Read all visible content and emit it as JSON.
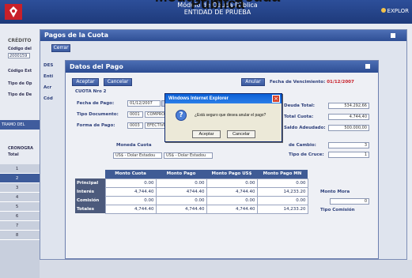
{
  "header": {
    "overlay_title": "Módulo de Deuda Pública",
    "title": "Módulo de Deuda Pública",
    "subtitle": "ENTIDAD DE PRUEBA",
    "user": "EXPLOR"
  },
  "background": {
    "credito_label": "CRÉDITO",
    "labels": [
      "Código del",
      "Código Ext",
      "Tipo de Op",
      "Tipo de De"
    ],
    "input_value": "2000159",
    "tramo_label": "TRAMO DEL",
    "cronograma_label": "CRONOGRA",
    "total_label": "Total",
    "grid_rows": [
      "1",
      "2",
      "3",
      "4",
      "5",
      "6",
      "7",
      "8"
    ]
  },
  "pagos_window": {
    "title": "Pagos de la Cuota",
    "cerrar": "Cerrar",
    "side_labels": [
      "DES",
      "Enti",
      "Acr",
      "Cód"
    ]
  },
  "datos_window": {
    "title": "Datos del Pago",
    "aceptar": "Aceptar",
    "cancelar": "Cancelar",
    "anular": "Anular",
    "fecha_venc_label": "Fecha de Vencimiento:",
    "fecha_venc_value": "01/12/2007",
    "cuota": "CUOTA Nro 2",
    "fecha_pago_label": "Fecha de Pago:",
    "fecha_pago_value": "01/12/2007",
    "tipo_doc_label": "Tipo Documento:",
    "tipo_doc_code": "0001",
    "tipo_doc_value": "COMPRO",
    "forma_pago_label": "Forma de Pago:",
    "forma_pago_code": "0003",
    "forma_pago_value": "EFECTIVO",
    "deuda_total_label": "Deuda Total:",
    "deuda_total_value": "534.292,66",
    "total_cuota_label": "Total Cuota:",
    "total_cuota_value": "4.744,40",
    "saldo_label": "Saldo Adeudado:",
    "saldo_value": "500.000,00",
    "tipo_cambio_label": "de Cambio:",
    "tipo_cambio_value": "3",
    "tipo_cruce_label": "Tipo de Cruce:",
    "tipo_cruce_value": "1",
    "moneda_cuota_label": "Moneda Cuota",
    "moneda_cuota_value": "US$ - Dolar Estadou",
    "moneda_pago_value": "US$ - Dolar Estadou",
    "monto_mora_label": "Monto Mora",
    "tipo_comision_label": "Tipo Comisión",
    "mora_value": "0"
  },
  "table": {
    "headers": [
      "Monto Cuota",
      "Monto Pago",
      "Monto Pago US$",
      "Monto Pago MN"
    ],
    "rows": [
      {
        "label": "Principal",
        "values": [
          "0.00",
          "0.00",
          "0.00",
          "0.00"
        ]
      },
      {
        "label": "Interés",
        "values": [
          "4,744.40",
          "4744.40",
          "4,744.40",
          "14,233.20"
        ]
      },
      {
        "label": "Comisión",
        "values": [
          "0.00",
          "0.00",
          "0.00",
          "0.00"
        ]
      },
      {
        "label": "Totales",
        "values": [
          "4,744.40",
          "4,744.40",
          "4,744.40",
          "14,233.20"
        ]
      }
    ]
  },
  "dialog": {
    "title": "Windows Internet Explorer",
    "message": "¿Está seguro que desea anular el pago?",
    "accept": "Aceptar",
    "cancel": "Cancelar"
  }
}
